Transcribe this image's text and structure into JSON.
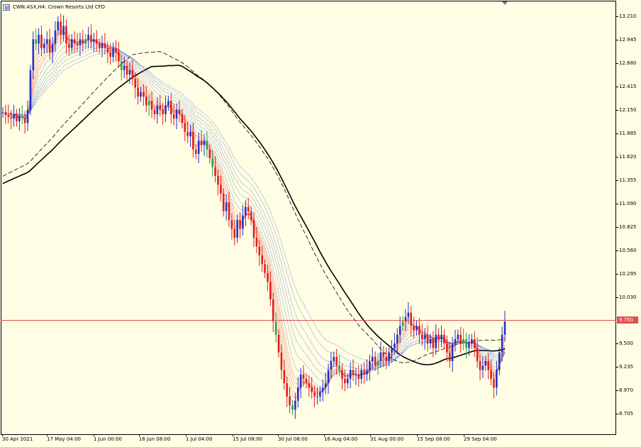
{
  "window": {
    "title": "CWN.ASX,H4:  Crown Resorts Ltd CFD",
    "icon": "chart-window-icon"
  },
  "price_axis": {
    "labels": [
      "13.210",
      "12.945",
      "12.680",
      "12.415",
      "12.150",
      "11.885",
      "11.620",
      "11.355",
      "11.090",
      "10.825",
      "10.560",
      "10.295",
      "10.030",
      "9.500",
      "9.235",
      "8.970",
      "8.705"
    ],
    "current_price": "9.750"
  },
  "time_axis": {
    "labels": [
      "30 Apr 2021",
      "17 May 04:00",
      "1 Jun 00:00",
      "16 Jun 08:00",
      "1 Jul 04:00",
      "15 Jul 08:00",
      "30 Jul 08:00",
      "16 Aug 04:00",
      "31 Aug 00:00",
      "15 Sep 08:00",
      "29 Sep 04:00"
    ]
  },
  "colors": {
    "background": "#fffee4",
    "bull_candle": "#2430c8",
    "bear_candle": "#e21d1d",
    "green_candle": "#2aa24a",
    "fast_ribbon": "#e03030",
    "slow_ribbon": "#3050d8",
    "ma_long": "#000000",
    "price_line": "#e05050"
  },
  "chart_data": {
    "type": "candlestick",
    "symbol": "CWN.ASX",
    "timeframe": "H4",
    "ylim": [
      8.6,
      13.3
    ],
    "closes": [
      12.12,
      12.09,
      12.07,
      12.05,
      12.1,
      12.02,
      12.08,
      12.06,
      12.0,
      12.15,
      12.6,
      12.95,
      12.9,
      13.0,
      12.85,
      12.9,
      12.95,
      12.8,
      12.9,
      13.05,
      13.15,
      13.0,
      13.1,
      12.9,
      12.85,
      12.95,
      12.9,
      12.88,
      12.95,
      12.9,
      12.95,
      13.0,
      12.92,
      12.95,
      12.9,
      12.85,
      12.9,
      12.85,
      12.8,
      12.75,
      12.85,
      12.8,
      12.7,
      12.6,
      12.65,
      12.55,
      12.6,
      12.5,
      12.4,
      12.3,
      12.35,
      12.3,
      12.2,
      12.25,
      12.15,
      12.1,
      12.2,
      12.15,
      12.1,
      12.2,
      12.25,
      12.1,
      12.05,
      12.15,
      12.1,
      12.0,
      11.9,
      11.85,
      11.9,
      11.7,
      11.65,
      11.8,
      11.75,
      11.8,
      11.7,
      11.6,
      11.5,
      11.4,
      11.3,
      11.2,
      11.0,
      11.1,
      10.9,
      10.8,
      10.7,
      10.9,
      10.8,
      10.95,
      11.05,
      11.0,
      10.9,
      10.7,
      10.6,
      10.5,
      10.4,
      10.3,
      10.2,
      10.0,
      9.75,
      9.6,
      9.4,
      9.2,
      9.05,
      8.9,
      8.8,
      8.75,
      8.85,
      9.0,
      9.15,
      9.1,
      9.05,
      9.0,
      8.95,
      8.9,
      8.9,
      8.95,
      9.0,
      9.05,
      9.2,
      9.3,
      9.35,
      9.25,
      9.2,
      9.1,
      9.05,
      9.1,
      9.2,
      9.15,
      9.15,
      9.1,
      9.2,
      9.15,
      9.2,
      9.3,
      9.35,
      9.25,
      9.3,
      9.4,
      9.35,
      9.3,
      9.4,
      9.45,
      9.5,
      9.6,
      9.7,
      9.75,
      9.8,
      9.85,
      9.7,
      9.65,
      9.7,
      9.6,
      9.55,
      9.6,
      9.5,
      9.55,
      9.45,
      9.6,
      9.55,
      9.6,
      9.5,
      9.4,
      9.3,
      9.5,
      9.55,
      9.6,
      9.5,
      9.55,
      9.45,
      9.5,
      9.55,
      9.45,
      9.3,
      9.2,
      9.25,
      9.3,
      9.2,
      9.1,
      9.0,
      9.2,
      9.4,
      9.6,
      9.75
    ]
  }
}
